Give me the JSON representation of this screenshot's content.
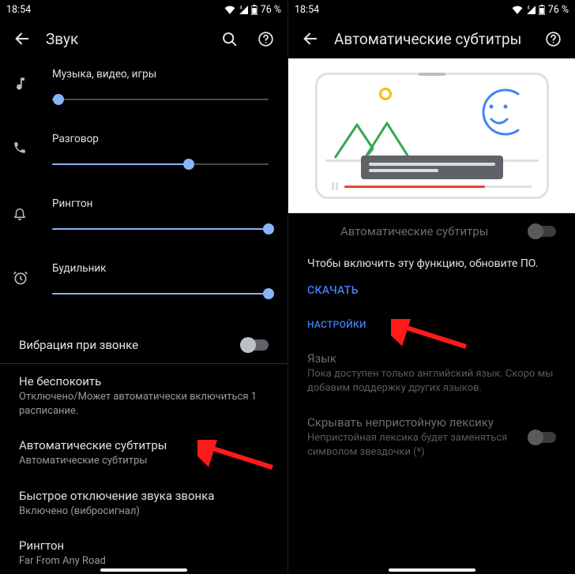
{
  "status": {
    "time": "18:54",
    "battery": "76 %"
  },
  "left": {
    "title": "Звук",
    "sliders": {
      "media": {
        "label": "Музыка, видео, игры",
        "percent": 3
      },
      "call": {
        "label": "Разговор",
        "percent": 63
      },
      "ring": {
        "label": "Рингтон",
        "percent": 100
      },
      "alarm": {
        "label": "Будильник",
        "percent": 100
      }
    },
    "vibrate": {
      "label": "Вибрация при звонке",
      "on": false
    },
    "items": {
      "dnd": {
        "title": "Не беспокоить",
        "sub": "Отключено/Может автоматически включиться 1 расписание."
      },
      "captions": {
        "title": "Автоматические субтитры",
        "sub": "Автоматические субтитры"
      },
      "mute_shortcut": {
        "title": "Быстрое отключение звука звонка",
        "sub": "Включено (вибросигнал)"
      },
      "ringtone": {
        "title": "Рингтон",
        "sub": "Far From Any Road"
      }
    }
  },
  "right": {
    "title": "Автоматические субтитры",
    "main_toggle": {
      "label": "Автоматические субтитры",
      "on": false,
      "disabled": true
    },
    "info": "Чтобы включить эту функцию, обновите ПО.",
    "download": "СКАЧАТЬ",
    "section": "НАСТРОЙКИ",
    "language": {
      "title": "Язык",
      "sub": "Пока доступен только английский язык. Скоро мы добавим поддержку других языков."
    },
    "profanity": {
      "title": "Скрывать непристойную лексику",
      "sub": "Непристойная лексика будет заменяться символом звездочки (*)",
      "on": false,
      "disabled": true
    }
  }
}
